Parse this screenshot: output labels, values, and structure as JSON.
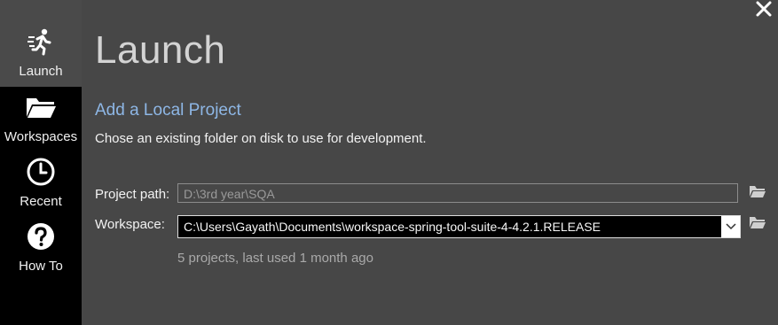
{
  "sidebar": {
    "items": [
      {
        "label": "Launch",
        "icon": "run-icon",
        "active": true
      },
      {
        "label": "Workspaces",
        "icon": "folder-open-icon",
        "active": false
      },
      {
        "label": "Recent",
        "icon": "clock-icon",
        "active": false
      },
      {
        "label": "How To",
        "icon": "question-icon",
        "active": false
      }
    ]
  },
  "window": {
    "close_icon": "close-icon"
  },
  "main": {
    "title": "Launch",
    "subtitle": "Add a Local Project",
    "description": "Chose an existing folder on disk to use for development.",
    "project_path": {
      "label": "Project path:",
      "value": "D:\\3rd year\\SQA"
    },
    "workspace": {
      "label": "Workspace:",
      "value": "C:\\Users\\Gayath\\Documents\\workspace-spring-tool-suite-4-4.2.1.RELEASE"
    },
    "workspace_info": "5 projects, last used 1 month ago"
  },
  "colors": {
    "accent": "#8eb7e6",
    "background": "#474747",
    "sidebar": "#000000"
  }
}
